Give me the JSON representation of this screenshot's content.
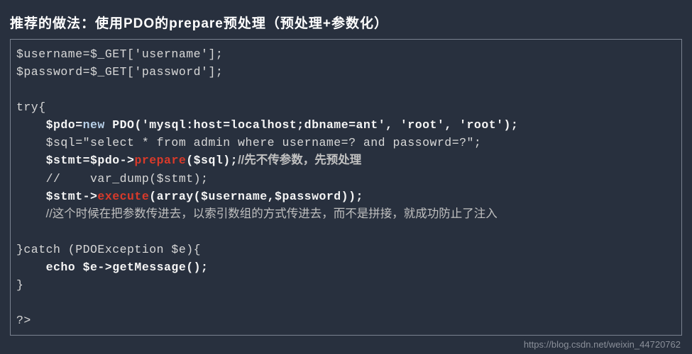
{
  "title": "推荐的做法：使用PDO的prepare预处理（预处理+参数化）",
  "code": {
    "line1": "$username=$_GET['username'];",
    "line2": "$password=$_GET['password'];",
    "line3": "",
    "line4": "try{",
    "line5_pre": "    $pdo=",
    "line5_new": "new",
    "line5_rest": " PDO('mysql:host=localhost;dbname=ant', 'root', 'root');",
    "line6": "    $sql=\"select * from admin where username=? and passowrd=?\";",
    "line7_pre": "    $stmt=$pdo->",
    "line7_hl": "prepare",
    "line7_mid": "($sql);",
    "line7_comment": "//先不传参数，先预处理",
    "line8": "    //    var_dump($stmt);",
    "line9_pre": "    $stmt->",
    "line9_hl": "execute",
    "line9_rest": "(array($username,$password));",
    "line10_pre": "    ",
    "line10_comment": "//这个时候在把参数传进去，以索引数组的方式传进去，而不是拼接，就成功防止了注入",
    "line11": "",
    "line12": "}catch (PDOException $e){",
    "line13": "    echo $e->getMessage();",
    "line14": "}",
    "line15": "",
    "line16": "?>"
  },
  "watermark": "https://blog.csdn.net/weixin_44720762"
}
